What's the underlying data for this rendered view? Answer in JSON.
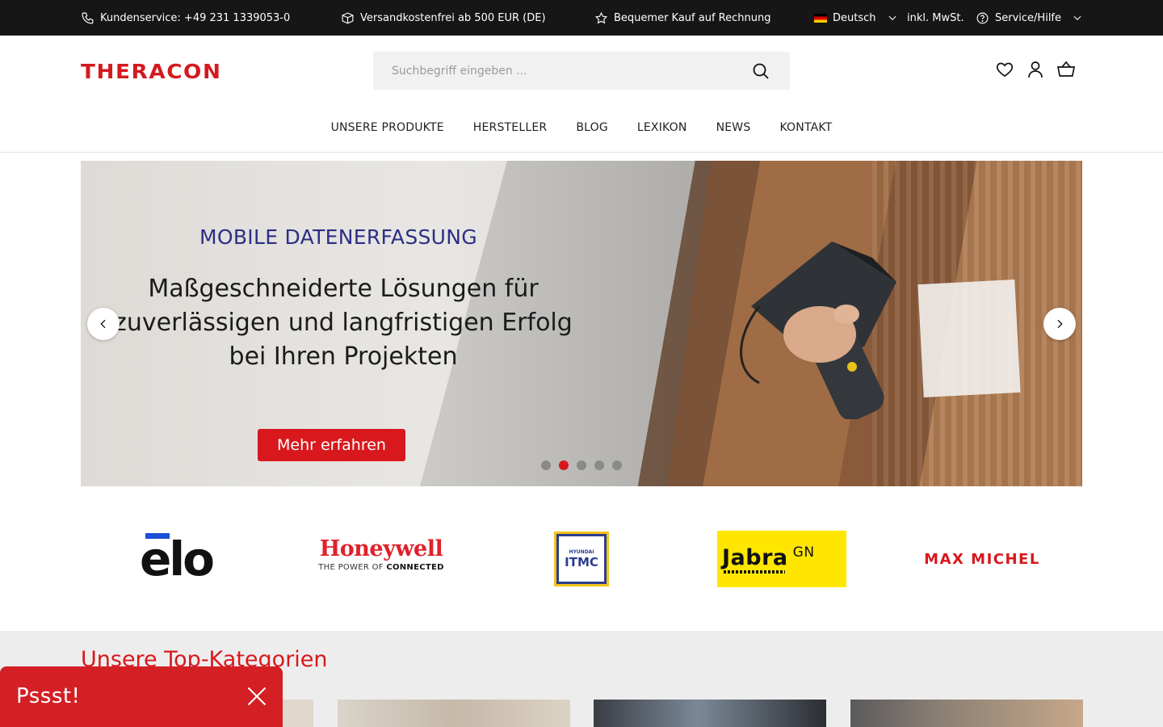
{
  "topbar": {
    "service": "Kundenservice: +49 231 1339053-0",
    "shipping": "Versandkostenfrei ab 500 EUR (DE)",
    "invoice": "Bequemer Kauf auf Rechnung",
    "language": "Deutsch",
    "tax": "inkl. MwSt.",
    "help": "Service/Hilfe"
  },
  "header": {
    "logo": "THERACON",
    "search_placeholder": "Suchbegriff eingeben ..."
  },
  "nav": {
    "items": [
      "UNSERE PRODUKTE",
      "HERSTELLER",
      "BLOG",
      "LEXIKON",
      "NEWS",
      "KONTAKT"
    ]
  },
  "hero": {
    "kicker": "MOBILE DATENERFASSUNG",
    "headline": "Maßgeschneiderte Lösungen für zuverlässigen und langfristigen Erfolg bei Ihren Projekten",
    "cta": "Mehr erfahren",
    "slides_total": 5,
    "active_slide": 2
  },
  "brands": {
    "elo": "elo",
    "honeywell_name": "Honeywell",
    "honeywell_sub_a": "THE POWER OF ",
    "honeywell_sub_b": "CONNECTED",
    "itmc_top": "HYUNDAI",
    "itmc_main": "ITMC",
    "jabra": "Jabra",
    "jabra_gn": "GN",
    "maxmichel": "MAX MICHEL"
  },
  "categories": {
    "title": "Unsere Top-Kategorien"
  },
  "popup": {
    "text": "Pssst!"
  },
  "colors": {
    "brand_red": "#d8181d",
    "topbar_bg": "#161616",
    "kicker_blue": "#2b2f86"
  }
}
